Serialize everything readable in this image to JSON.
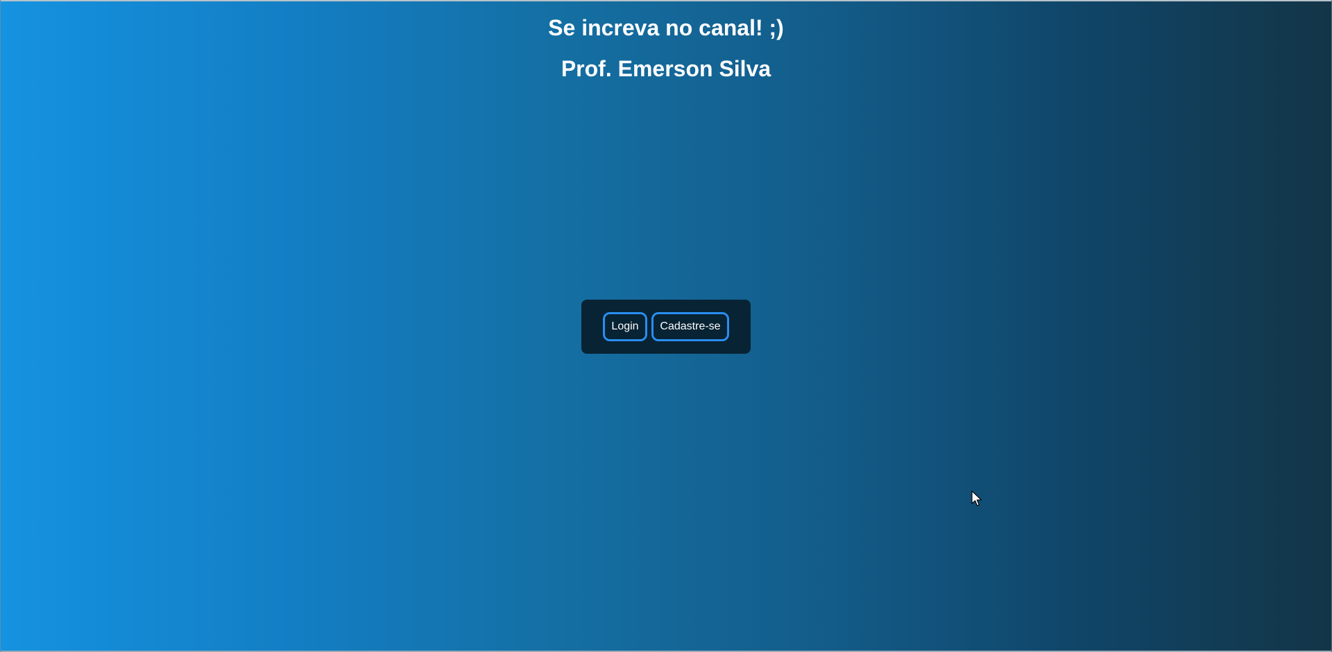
{
  "header": {
    "subscribe_text": "Se increva no canal! ;)",
    "author_text": "Prof. Emerson Silva"
  },
  "auth": {
    "login_label": "Login",
    "signup_label": "Cadastre-se"
  },
  "colors": {
    "gradient_start": "#1592e0",
    "gradient_end": "#133547",
    "box_background": "#082334",
    "button_border": "#2a8ef0",
    "text": "#ffffff"
  },
  "icons": {
    "cursor": "mouse-pointer-icon"
  }
}
